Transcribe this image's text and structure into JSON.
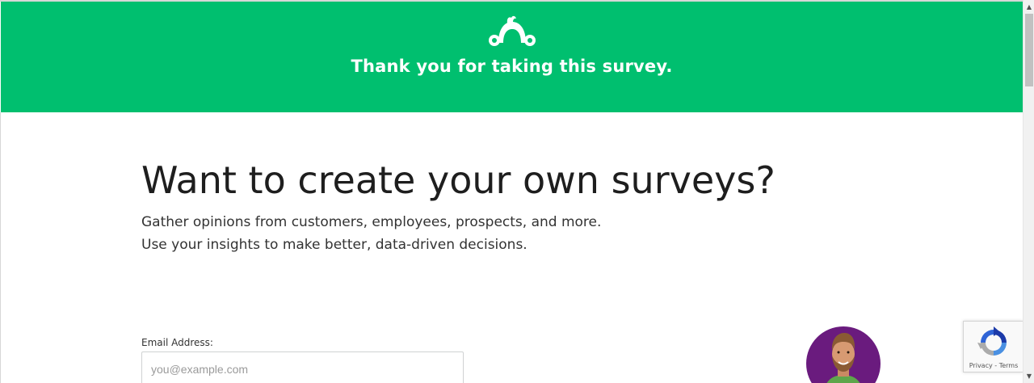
{
  "banner": {
    "title": "Thank you for taking this survey.",
    "logo_icon": "surveymonkey-logo-icon",
    "background_color": "#00bf6f"
  },
  "promo": {
    "headline": "Want to create your own surveys?",
    "lines": [
      "Gather opinions from customers, employees, prospects, and more.",
      "Use your insights to make better, data-driven decisions."
    ]
  },
  "form": {
    "email_label": "Email Address:",
    "email_placeholder": "you@example.com",
    "email_value": ""
  },
  "avatar": {
    "icon": "person-avatar-icon",
    "accent_color": "#6a1b7e"
  },
  "recaptcha": {
    "icon": "recaptcha-icon",
    "links": "Privacy - Terms"
  },
  "scrollbar": {
    "up_arrow": "▲",
    "down_arrow": "▼"
  }
}
